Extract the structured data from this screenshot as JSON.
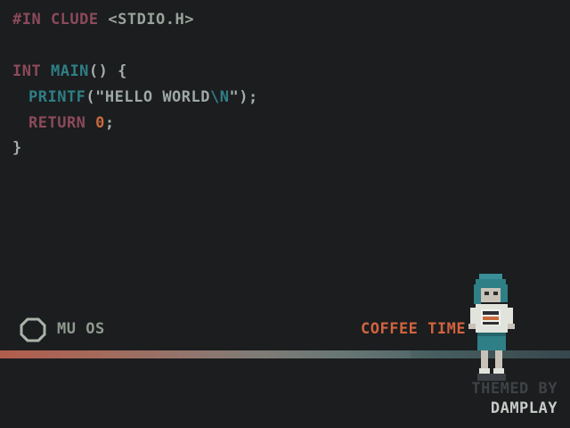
{
  "code": {
    "line1": {
      "pre": "#IN CLUDE",
      "header": "<STDIO.H>"
    },
    "line2": {
      "type": "INT",
      "name": "MAIN",
      "rest": "() {"
    },
    "line3": {
      "fn": "PRINTF",
      "open": "(\"",
      "text": "HELLO WORLD",
      "esc": "\\N",
      "close": "\");"
    },
    "line4": {
      "kw": "RETURN",
      "num": "0",
      "end": ";"
    },
    "line5": {
      "brace": "}"
    }
  },
  "status": {
    "os_name": "MU OS",
    "os_icon": "mu-logo-icon",
    "theme_title": "COFFEE TIME"
  },
  "progress": {
    "fraction": 0.72
  },
  "credits": {
    "line1": "THEMED BY",
    "line2": "DAMPLAY"
  },
  "colors": {
    "background": "#1b1d1f",
    "accent_orange": "#d2643e",
    "teal": "#2f7f86",
    "maroon": "#8c4a5a"
  }
}
